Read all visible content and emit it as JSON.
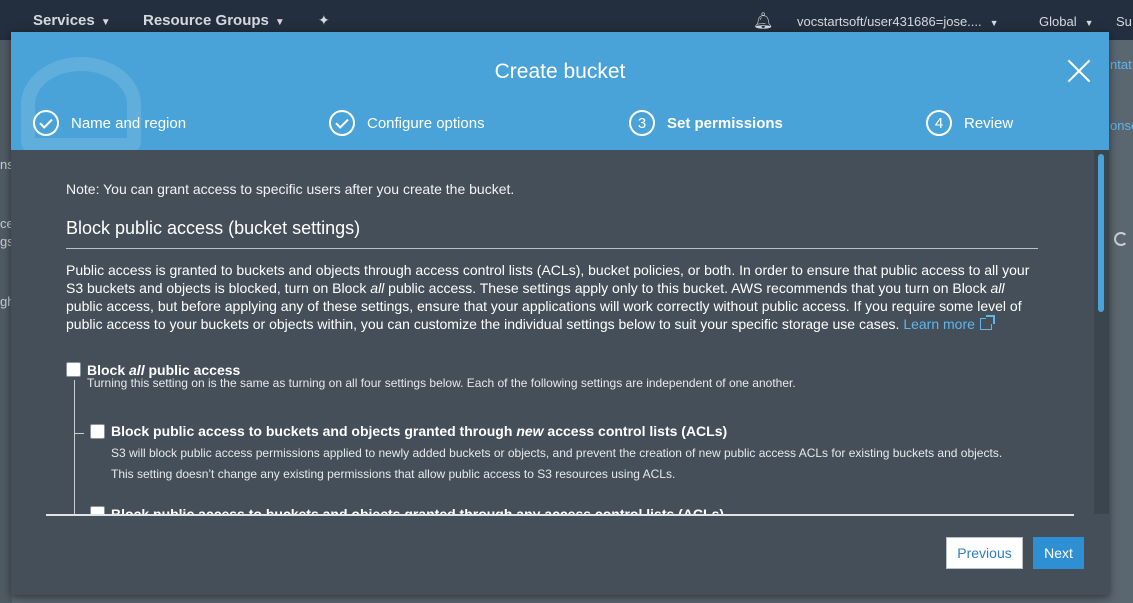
{
  "topnav": {
    "services": "Services",
    "resource_groups": "Resource Groups",
    "account": "vocstartsoft/user431686=jose....",
    "region": "Global",
    "support_fragment": "Su"
  },
  "background": {
    "frag_top_right": "ntat",
    "frag_cons": "onso",
    "frag_left_1": "ns",
    "frag_left_2": "ce",
    "frag_left_3": "gs",
    "frag_left_4": "gh"
  },
  "modal": {
    "title": "Create bucket",
    "steps": [
      {
        "number": "1",
        "label": "Name and region",
        "state": "complete"
      },
      {
        "number": "2",
        "label": "Configure options",
        "state": "complete"
      },
      {
        "number": "3",
        "label": "Set permissions",
        "state": "active"
      },
      {
        "number": "4",
        "label": "Review",
        "state": "pending"
      }
    ],
    "note": "Note: You can grant access to specific users after you create the bucket.",
    "section_title": "Block public access (bucket settings)",
    "description": {
      "part1": "Public access is granted to buckets and objects through access control lists (ACLs), bucket policies, or both. In order to ensure that public access to all your S3 buckets and objects is blocked, turn on Block ",
      "em1": "all",
      "part2": " public access. These settings apply only to this bucket. AWS recommends that you turn on Block ",
      "em2": "all",
      "part3": " public access, but before applying any of these settings, ensure that your applications will work correctly without public access. If you require some level of public access to your buckets or objects within, you can customize the individual settings below to suit your specific storage use cases. ",
      "learn_more": "Learn more"
    },
    "options": {
      "block_all": {
        "prefix": "Block ",
        "em": "all",
        "suffix": " public access",
        "desc": "Turning this setting on is the same as turning on all four settings below. Each of the following settings are independent of one another.",
        "checked": false
      },
      "block_new_acls": {
        "prefix": "Block public access to buckets and objects granted through ",
        "em": "new",
        "suffix": " access control lists (ACLs)",
        "desc_line1": "S3 will block public access permissions applied to newly added buckets or objects, and prevent the creation of new public access ACLs for existing buckets and objects.",
        "desc_line2": "This setting doesn’t change any existing permissions that allow public access to S3 resources using ACLs.",
        "checked": false
      },
      "block_any_acls": {
        "label": "Block public access to buckets and objects granted through any access control lists (ACLs)",
        "checked": false
      }
    },
    "buttons": {
      "previous": "Previous",
      "next": "Next"
    }
  },
  "colors": {
    "header": "#4aa3d8",
    "modal_body": "#444f59",
    "topnav": "#232f3e",
    "link": "#5fb6ec",
    "primary_button": "#2e8fd2"
  }
}
